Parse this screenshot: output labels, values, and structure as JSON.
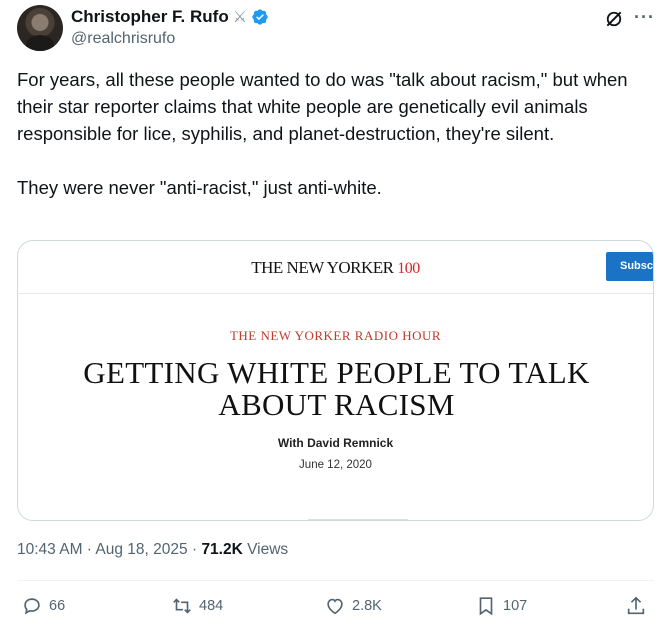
{
  "author": {
    "name": "Christopher F. Rufo",
    "handle": "@realchrisrufo",
    "badge_icon": "crossed-swords-icon",
    "verified_icon": "verified-badge-icon",
    "verified_color": "#1d9bf0"
  },
  "tweet": {
    "text": "For years, all these people wanted to do was \"talk about racism,\" but when their star reporter claims that white people are genetically evil animals responsible for lice, syphilis, and planet-destruction, they're silent.\n\nThey were never \"anti-racist,\" just anti-white."
  },
  "card": {
    "logo_text": "THE NEW YORKER",
    "logo_suffix": "100",
    "subscribe_label": "Subscri",
    "kicker": "THE NEW YORKER RADIO HOUR",
    "headline": "GETTING WHITE PEOPLE TO TALK ABOUT RACISM",
    "byline": "With David Remnick",
    "date": "June 12, 2020",
    "accent_color": "#c0392b"
  },
  "meta": {
    "time": "10:43 AM",
    "separator": " · ",
    "date": "Aug 18, 2025",
    "separator2": " · ",
    "views_count": "71.2K",
    "views_label": " Views"
  },
  "actions": {
    "replies": "66",
    "reposts": "484",
    "likes": "2.8K",
    "bookmarks": "107"
  },
  "icons": {
    "grok": "grok-icon",
    "more": "more-options-icon",
    "reply": "reply-icon",
    "repost": "repost-icon",
    "like": "heart-icon",
    "bookmark": "bookmark-icon",
    "share": "share-icon"
  }
}
